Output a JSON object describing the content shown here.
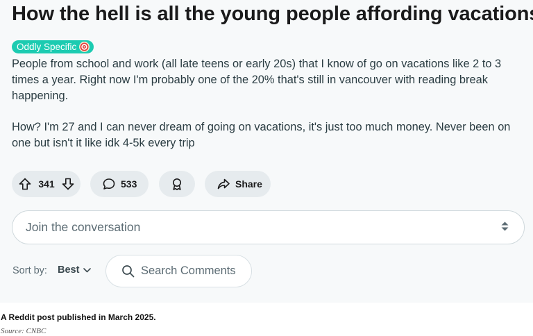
{
  "post": {
    "title": "How the hell is all the young people affording vacations?",
    "flair": "Oddly Specific",
    "flair_icon": "dartboard-emoji",
    "paragraphs": [
      "People from school and work (all late teens or early 20s) that I know of go on vacations like 2 to 3 times a year. Right now I'm probably one of the 20% that's still in vancouver with reading break happening.",
      "How? I'm 27 and I can never dream of going on vacations, it's just too much money. Never been on one but isn't it like idk 4-5k every trip"
    ]
  },
  "actions": {
    "upvote_icon": "arrow-up-icon",
    "vote_count": "341",
    "downvote_icon": "arrow-down-icon",
    "comment_icon": "speech-bubble-icon",
    "comment_count": "533",
    "award_icon": "award-ribbon-icon",
    "share_icon": "share-arrow-icon",
    "share_label": "Share"
  },
  "comment_box": {
    "placeholder": "Join the conversation"
  },
  "sort": {
    "label": "Sort by:",
    "value": "Best"
  },
  "search": {
    "placeholder": "Search Comments"
  },
  "caption": {
    "text": "A Reddit post published in March 2025.",
    "source": "Source: CNBC"
  },
  "colors": {
    "flair_bg": "#1ccbb1",
    "pill_bg": "#e6ebee",
    "page_bg": "#f7f9fa"
  }
}
